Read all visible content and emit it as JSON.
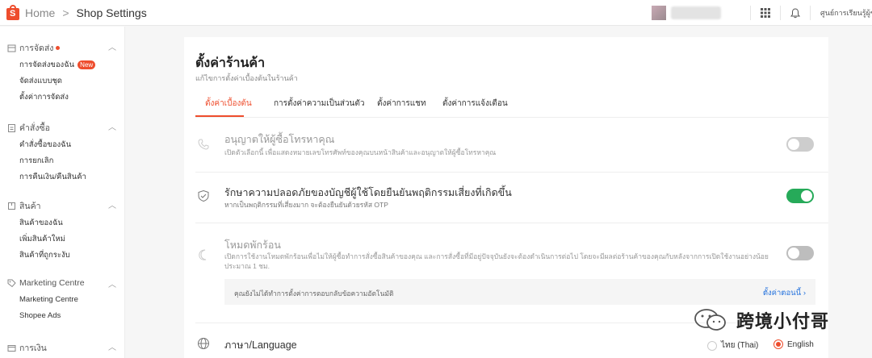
{
  "header": {
    "home_label": "Home",
    "separator": ">",
    "current_page": "Shop Settings",
    "seller_center_label": "ศูนย์การเรียนรู้ผู้ขาย"
  },
  "sidebar": {
    "sections": [
      {
        "title": "การจัดส่ง",
        "icon": "shipping-box-icon",
        "items": [
          "การจัดส่งของฉัน",
          "จัดส่งแบบชุด",
          "ตั้งค่าการจัดส่ง"
        ],
        "new_badge": "New"
      },
      {
        "title": "คำสั่งซื้อ",
        "icon": "clipboard-icon",
        "items": [
          "คำสั่งซื้อของฉัน",
          "การยกเลิก",
          "การคืนเงิน/คืนสินค้า"
        ]
      },
      {
        "title": "สินค้า",
        "icon": "product-box-icon",
        "items": [
          "สินค้าของฉัน",
          "เพิ่มสินค้าใหม่",
          "สินค้าที่ถูกระงับ"
        ]
      },
      {
        "title": "Marketing Centre",
        "icon": "tag-icon",
        "items": [
          "Marketing Centre",
          "Shopee Ads"
        ]
      },
      {
        "title": "การเงิน",
        "icon": "wallet-icon",
        "items": []
      }
    ]
  },
  "main": {
    "title": "ตั้งค่าร้านค้า",
    "subtitle": "แก้ไขการตั้งค่าเบื้องต้นในร้านค้า",
    "tabs": [
      "ตั้งค่าเบื้องต้น",
      "การตั้งค่าความเป็นส่วนตัว",
      "ตั้งค่าการแชท",
      "ตั้งค่าการแจ้งเตือน"
    ],
    "active_tab": 0,
    "settings": [
      {
        "title": "อนุญาตให้ผู้ซื้อโทรหาคุณ",
        "description": "เปิดตัวเลือกนี้ เพื่อแสดงหมายเลขโทรศัพท์ของคุณบนหน้าสินค้าและอนุญาตให้ผู้ซื้อโทรหาคุณ",
        "icon": "phone-icon",
        "enabled": false
      },
      {
        "title": "รักษาความปลอดภัยของบัญชีผู้ใช้โดยยืนยันพฤติกรรมเสี่ยงที่เกิดขึ้น",
        "description": "หากเป็นพฤติกรรมที่เสี่ยงมาก จะต้องยืนยันด้วยรหัส OTP",
        "icon": "shield-check-icon",
        "enabled": true
      },
      {
        "title": "โหมดพักร้อน",
        "description": "เปิดการใช้งานโหมดพักร้อนเพื่อไม่ให้ผู้ซื้อทำการสั่งซื้อสินค้าของคุณ และการสั่งซื้อที่มีอยู่ปัจจุบันยังจะต้องดำเนินการต่อไป โดยจะมีผลต่อร้านค้าของคุณกับหลังจากการเปิดใช้งานอย่างน้อยประมาณ 1 ชม.",
        "icon": "moon-icon",
        "enabled": false
      }
    ],
    "autoreply_notice": "คุณยังไม่ได้ทำการตั้งค่าการตอบกลับข้อความอัตโนมัติ",
    "autoreply_link": "ตั้งค่าตอนนี้",
    "language": {
      "title": "ภาษา/Language",
      "icon": "globe-icon",
      "options": [
        "ไทย (Thai)",
        "English"
      ],
      "selected": "English"
    }
  },
  "watermark": {
    "text": "跨境小付哥"
  },
  "colors": {
    "accent": "#ee4d2d",
    "toggle_on": "#26aa59",
    "link": "#2673dd"
  }
}
